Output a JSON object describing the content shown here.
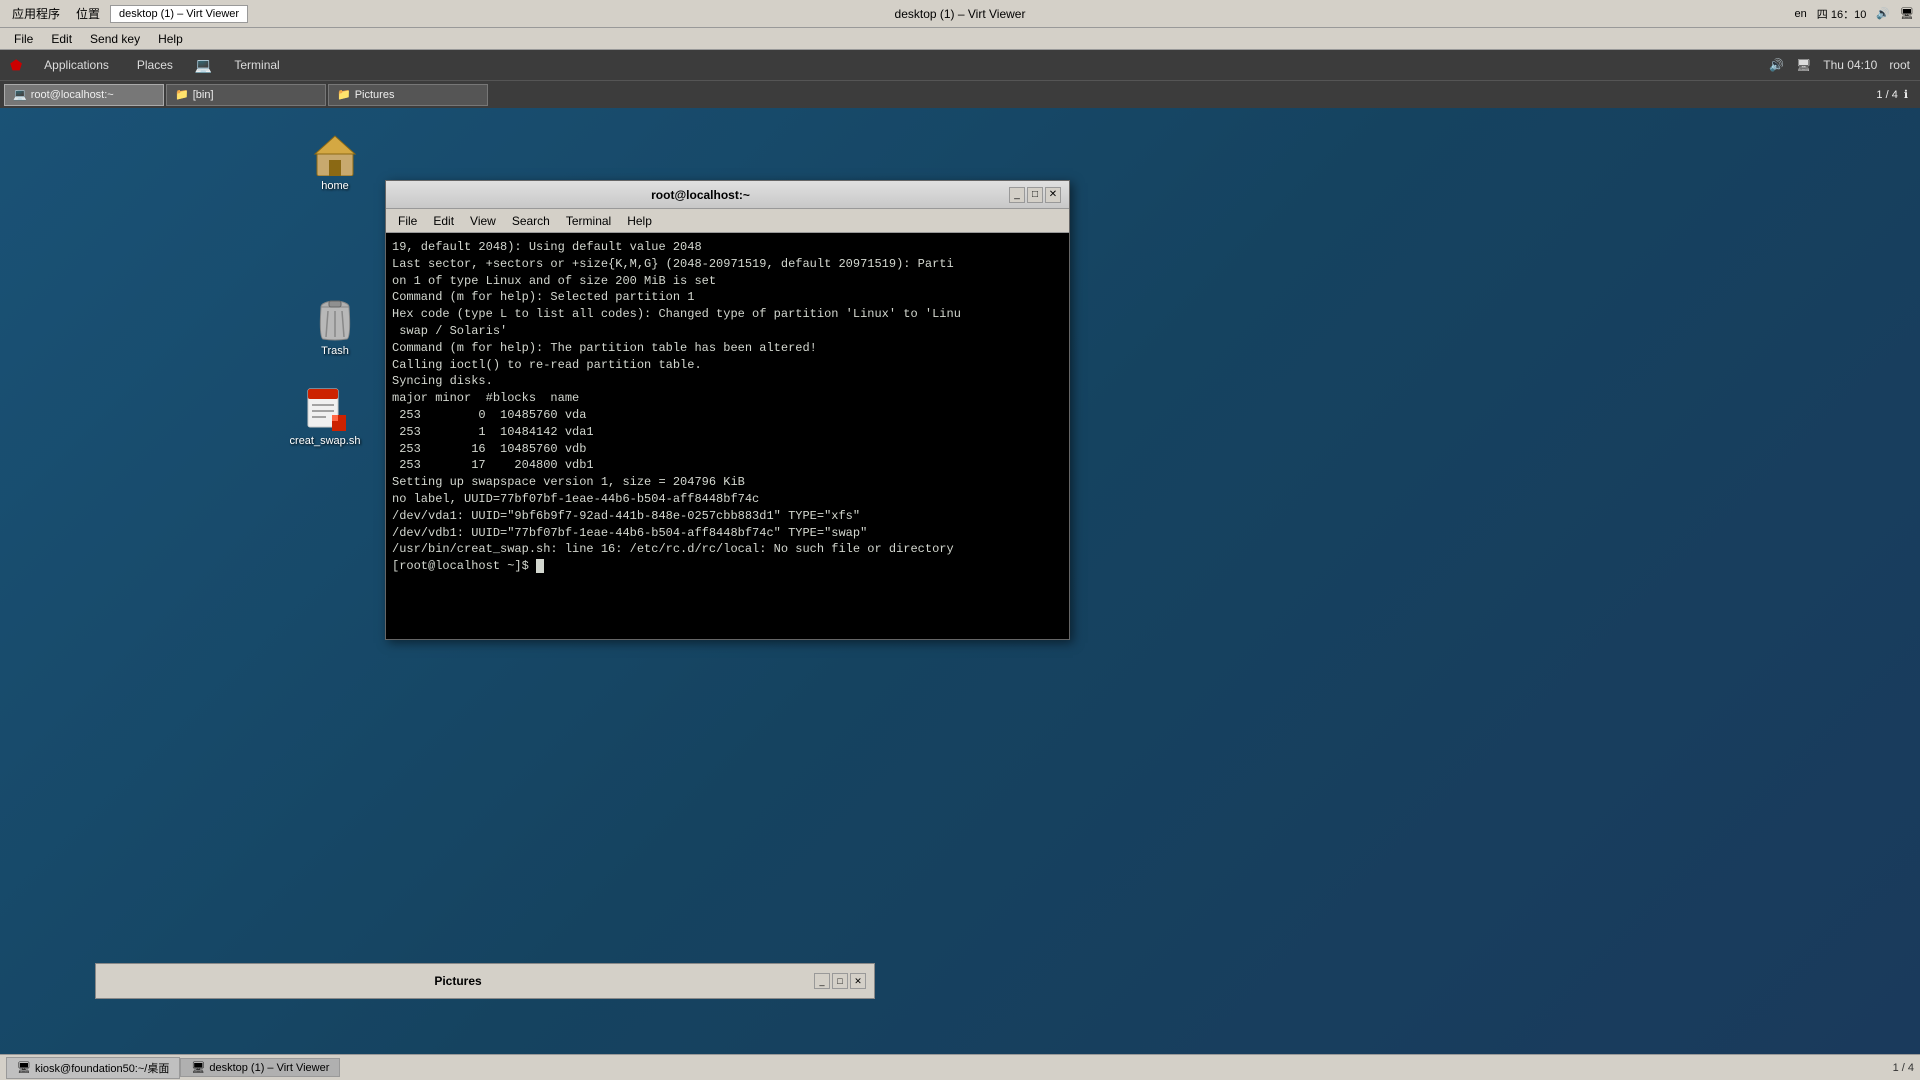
{
  "host_topbar": {
    "app_menu_label": "应用程序",
    "position_label": "位置",
    "active_window_label": "desktop (1) – Virt Viewer",
    "locale": "en",
    "time": "四 16：10",
    "title": "desktop (1) – Virt Viewer"
  },
  "host_menubar": {
    "file_label": "File",
    "edit_label": "Edit",
    "sendkey_label": "Send key",
    "help_label": "Help"
  },
  "vm_topbar": {
    "applications_label": "Applications",
    "places_label": "Places",
    "terminal_label": "Terminal",
    "time": "Thu 04:10",
    "user": "root"
  },
  "desktop": {
    "home_icon_label": "home",
    "trash_icon_label": "Trash",
    "script_icon_label": "creat_swap.sh"
  },
  "terminal_window": {
    "title": "root@localhost:~",
    "menu": {
      "file": "File",
      "edit": "Edit",
      "view": "View",
      "search": "Search",
      "terminal": "Terminal",
      "help": "Help"
    },
    "content": [
      "19, default 2048): Using default value 2048",
      "Last sector, +sectors or +size{K,M,G} (2048-20971519, default 20971519): Parti",
      "on 1 of type Linux and of size 200 MiB is set",
      "",
      "Command (m for help): Selected partition 1",
      "Hex code (type L to list all codes): Changed type of partition 'Linux' to 'Linu",
      " swap / Solaris'",
      "",
      "Command (m for help): The partition table has been altered!",
      "",
      "Calling ioctl() to re-read partition table.",
      "Syncing disks.",
      "major minor  #blocks  name",
      "",
      " 253        0  10485760 vda",
      " 253        1  10484142 vda1",
      " 253       16  10485760 vdb",
      " 253       17    204800 vdb1",
      "Setting up swapspace version 1, size = 204796 KiB",
      "no label, UUID=77bf07bf-1eae-44b6-b504-aff8448bf74c",
      "/dev/vda1: UUID=\"9bf6b9f7-92ad-441b-848e-0257cbb883d1\" TYPE=\"xfs\"",
      "/dev/vdb1: UUID=\"77bf07bf-1eae-44b6-b504-aff8448bf74c\" TYPE=\"swap\"",
      "/usr/bin/creat_swap.sh: line 16: /etc/rc.d/rc/local: No such file or directory",
      "[root@localhost ~]$ "
    ]
  },
  "pictures_window": {
    "title": "Pictures"
  },
  "vm_taskbar": {
    "items": [
      {
        "label": "root@localhost:~",
        "icon": "terminal"
      },
      {
        "label": "[bin]",
        "icon": "folder"
      },
      {
        "label": "Pictures",
        "icon": "folder"
      }
    ],
    "page_indicator": "1 / 4",
    "info_label": "ℹ"
  },
  "host_bottombar": {
    "items": [
      {
        "label": "kiosk@foundation50:~/桌面"
      },
      {
        "label": "desktop (1) – Virt Viewer",
        "active": true
      }
    ],
    "page_indicator": "1 / 4"
  }
}
